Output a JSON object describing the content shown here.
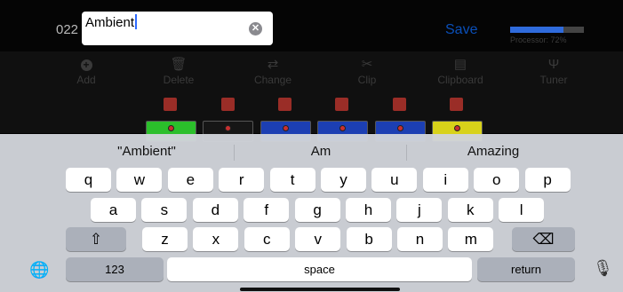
{
  "app": {
    "preset_number": "022",
    "name_input_value": "Ambient",
    "clear_label": "✕",
    "save_label": "Save",
    "processor_label": "Processor: 72%",
    "processor_percent": 72
  },
  "toolbar": {
    "items": [
      {
        "label": "Add",
        "icon": "add-icon"
      },
      {
        "label": "Delete",
        "icon": "trash-icon"
      },
      {
        "label": "Change",
        "icon": "change-icon"
      },
      {
        "label": "Clip",
        "icon": "scissors-icon"
      },
      {
        "label": "Clipboard",
        "icon": "clipboard-icon"
      },
      {
        "label": "Tuner",
        "icon": "tuner-icon"
      }
    ]
  },
  "pedals": [
    {
      "color": "#2bbf2b"
    },
    {
      "color": "#161616"
    },
    {
      "color": "#1c3fb3"
    },
    {
      "color": "#1c3fb3"
    },
    {
      "color": "#1c3fb3"
    },
    {
      "color": "#d8d21a"
    }
  ],
  "keyboard": {
    "suggestions": [
      "\"Ambient\"",
      "Am",
      "Amazing"
    ],
    "row1": [
      "q",
      "w",
      "e",
      "r",
      "t",
      "y",
      "u",
      "i",
      "o",
      "p"
    ],
    "row2": [
      "a",
      "s",
      "d",
      "f",
      "g",
      "h",
      "j",
      "k",
      "l"
    ],
    "row3": [
      "z",
      "x",
      "c",
      "v",
      "b",
      "n",
      "m"
    ],
    "shift_glyph": "⇧",
    "delete_glyph": "⌫",
    "numbers_label": "123",
    "space_label": "space",
    "return_label": "return",
    "globe_glyph": "🌐",
    "mic_glyph": "🎙"
  }
}
